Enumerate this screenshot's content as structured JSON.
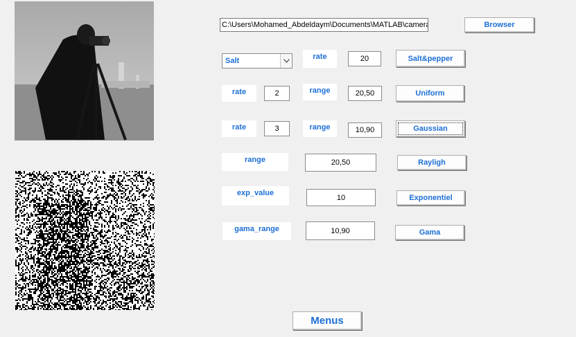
{
  "file_path": "C:\\Users\\Mohamed_Abdeldaym\\Documents\\MATLAB\\cameraman.tif",
  "buttons": {
    "browser": "Browser",
    "salt_pepper": "Salt&pepper",
    "uniform": "Uniform",
    "gaussian": "Gaussian",
    "rayligh": "Rayligh",
    "exponentiel": "Exponentiel",
    "gama": "Gama",
    "menus": "Menus"
  },
  "salt_pepper": {
    "type_selected": "Salt",
    "rate_label": "rate",
    "rate_value": "20"
  },
  "uniform": {
    "rate_label": "rate",
    "rate_value": "2",
    "range_label": "range",
    "range_value": "20,50"
  },
  "gaussian": {
    "rate_label": "rate",
    "rate_value": "3",
    "range_label": "range",
    "range_value": "10,90"
  },
  "rayligh": {
    "range_label": "range",
    "range_value": "20,50"
  },
  "exponentiel": {
    "label": "exp_value",
    "value": "10"
  },
  "gama": {
    "label": "gama_range",
    "value": "10,90"
  },
  "colors": {
    "accent_text": "#1c6fd6",
    "window_bg": "#f0f0f0"
  }
}
